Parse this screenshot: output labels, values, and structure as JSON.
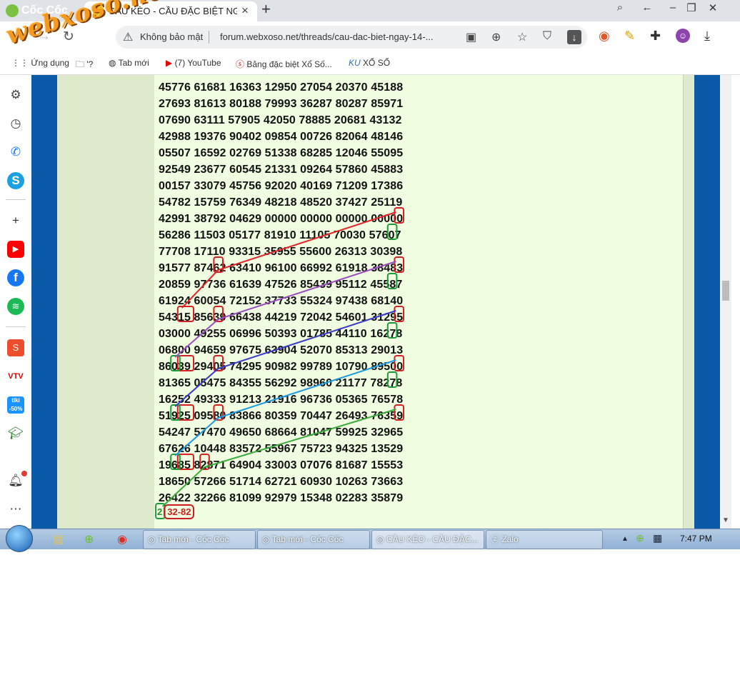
{
  "browser": {
    "brand": "Cốc Cốc",
    "active_tab": {
      "favicon": "XS",
      "title": "CẦU KÈO - CẦU ĐẶC BIỆT NG"
    },
    "new_tab_symbol": "+",
    "security_label": "Không bảo mật",
    "url": "forum.webxoso.net/threads/cau-dac-biet-ngay-14-..."
  },
  "bookmarks": [
    {
      "label": "Ứng dụng",
      "icon": "apps-icon"
    },
    {
      "label": "'?",
      "icon": "folder-icon"
    },
    {
      "label": "Tab mới",
      "icon": "globe-icon"
    },
    {
      "label": "(7) YouTube",
      "icon": "youtube-icon"
    },
    {
      "label": "Bảng đặc biệt Xổ Số...",
      "icon": "lottery-icon"
    },
    {
      "label": "XỔ SỐ",
      "icon": "ku-icon"
    }
  ],
  "watermark": "webxoso.net",
  "sidebar_icons": [
    "gear-icon",
    "history-icon",
    "messenger-icon",
    "skype-icon",
    "add-icon",
    "youtube-icon",
    "facebook-icon",
    "spotify-icon",
    "shopee-icon",
    "vtv-icon",
    "tiki-icon",
    "education-icon",
    "bell-icon",
    "more-icon"
  ],
  "post": {
    "rows": [
      "45776 61681 16363 12950 27054 20370 45188",
      "27693 81613 80188 79993 36287 80287 85971",
      "07690 63111 57905 42050 78885 20681 43132",
      "42988 19376 90402 09854 00726 82064 48146",
      "05507 16592 02769 51338 68285 12046 55095",
      "92549 23677 60545 21331 09264 57860 45883",
      "00157 33079 45756 92020 40169 71209 17386",
      "54782 15759 76349 48218 48520 37427 25119",
      "42991 38792 04629 00000 00000 00000 00000",
      "56286 11503 05177 81910 11105 70030 57607",
      "77708 17110 93315 35955 55600 26313 30398",
      "91577 87462 63410 96100 66992 61918 38483",
      "20859 97736 61639 47526 85439 95112 45587",
      "61924 60054 72152 37733 55324 97438 68140",
      "54315 85639 66438 44219 72042 54601 31295",
      "03000 49255 06996 50393 01785 44110 16278",
      "06800 94659 97675 63904 52070 85313 29013",
      "86039 29405 74295 90982 99789 10790 89500",
      "81365 05475 84355 56292 98960 21177 78278",
      "16252 49333 91213 21916 96736 05365 76578",
      "51925 09580 83866 80359 70447 26493 76359",
      "54247 57470 49650 68664 81047 59925 32965",
      "67626 10448 83572 55967 75723 94325 13529",
      "19685 82871 64904 33003 07076 81687 15553",
      "18650 57266 51714 62721 60930 10263 73663",
      "26422 32266 81099 92979 15348 02283 35879"
    ],
    "result_prefix": "2",
    "result_value": "32-82"
  },
  "overlay_colors": {
    "red_box": "#d42020",
    "green_box": "#1f9a3a",
    "line_red": "#e0262a",
    "line_purple": "#9a4fc0",
    "line_blue": "#3a3ac8",
    "line_cyan": "#1f9ae0",
    "line_green": "#3aaa3a"
  },
  "taskbar": {
    "tasks": [
      "Tab mới - Cốc Cốc",
      "Tab mới - Cốc Cốc",
      "CẦU KÈO - CẦU ĐẶC...",
      "Zalo"
    ],
    "time": "7:47 PM"
  }
}
